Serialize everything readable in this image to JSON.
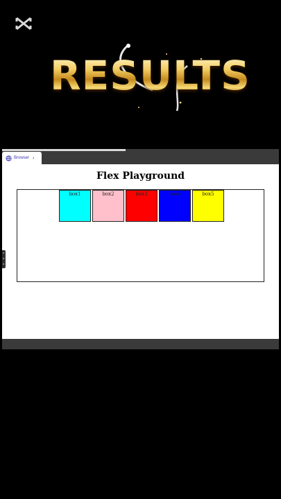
{
  "header": {
    "title": "RESULTS",
    "logo": "capcut-logo-icon"
  },
  "browser": {
    "tab_label": "Browser",
    "tab_icon": "globe-icon",
    "tab_chevron": "›"
  },
  "content": {
    "title": "Flex Playground",
    "boxes": [
      {
        "label": "box1",
        "color": "#00ffff"
      },
      {
        "label": "box2",
        "color": "#ffc0cb"
      },
      {
        "label": "box3",
        "color": "#ff0000"
      },
      {
        "label": "box4",
        "color": "#0000ff"
      },
      {
        "label": "box5",
        "color": "#ffff00"
      }
    ]
  },
  "colors": {
    "accent_gold": "#f2cc62",
    "browser_chrome": "#3a3a3a"
  }
}
